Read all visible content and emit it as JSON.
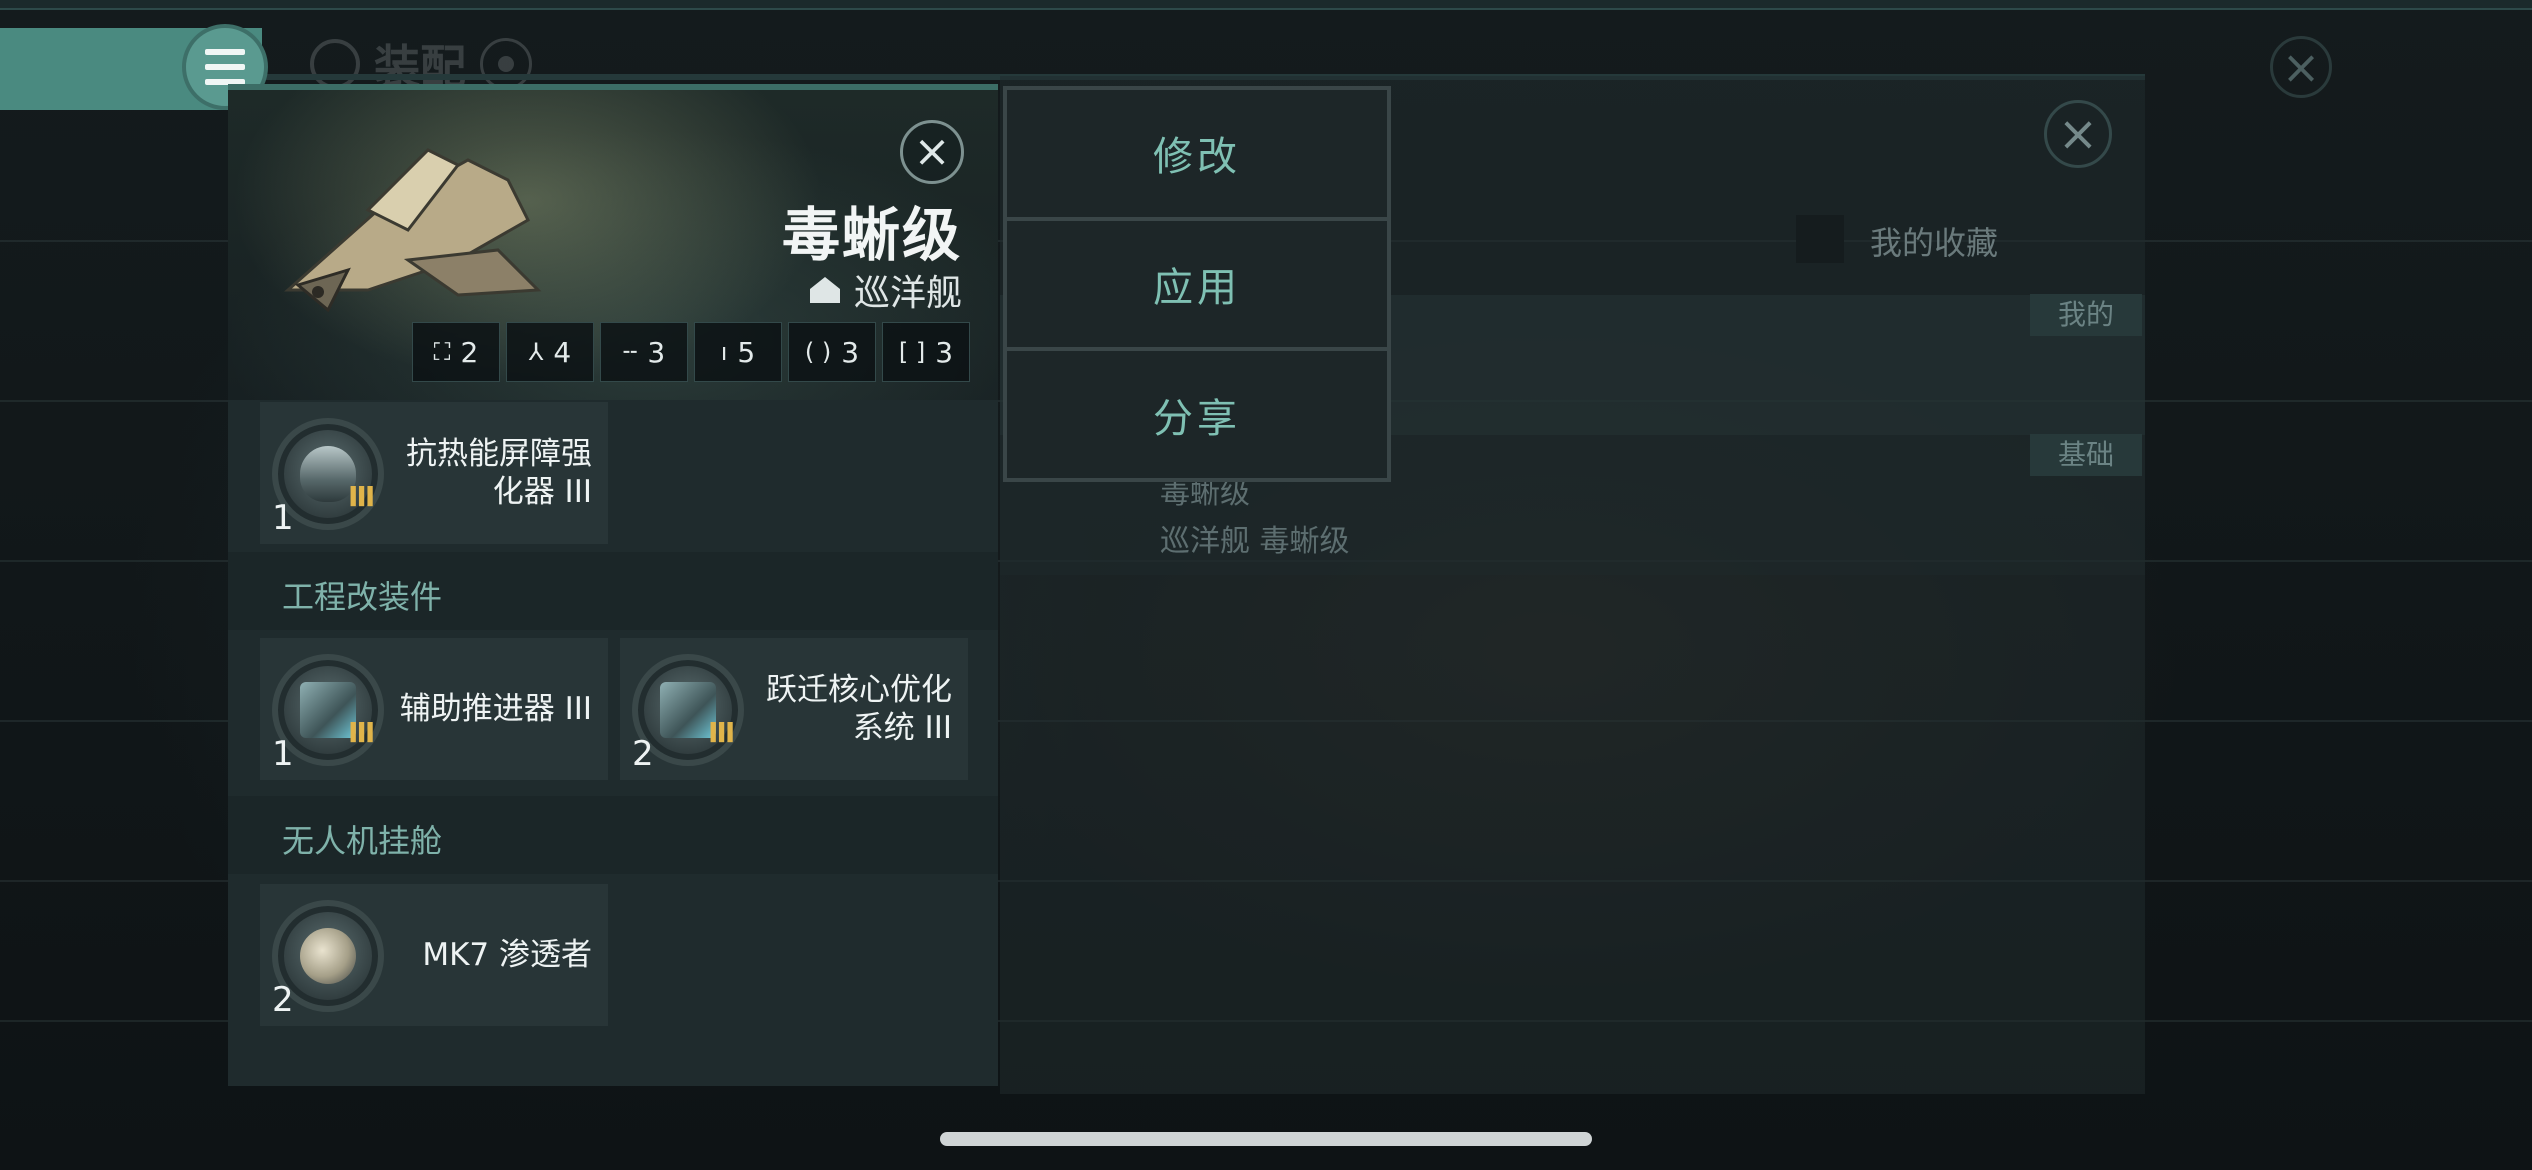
{
  "background": {
    "title": "装配",
    "favorites_label": "我的收藏",
    "tag_mine": "我的",
    "tag_base": "基础",
    "fit_name": "毒蜥级",
    "fit_sub": "巡洋舰 毒蜥级"
  },
  "card": {
    "ship_name": "毒蜥级",
    "ship_class": "巡洋舰",
    "slots": [
      {
        "icon": "high-slot-icon",
        "glyph": "⛶",
        "count": "2"
      },
      {
        "icon": "turret-icon",
        "glyph": "⅄",
        "count": "4"
      },
      {
        "icon": "mid-slot-icon",
        "glyph": "╌",
        "count": "3"
      },
      {
        "icon": "low-slot-icon",
        "glyph": "ı",
        "count": "5"
      },
      {
        "icon": "rig-slot-icon",
        "glyph": "( )",
        "count": "3"
      },
      {
        "icon": "subsystem-slot-icon",
        "glyph": "[ ]",
        "count": "3"
      }
    ],
    "modules_top": [
      {
        "qty": "1",
        "name": "抗热能屏障强化器 III",
        "tier": "III",
        "icon": "shield-hardener-icon"
      }
    ],
    "sections": [
      {
        "title": "工程改装件",
        "modules": [
          {
            "qty": "1",
            "name": "辅助推进器 III",
            "tier": "III",
            "icon": "thruster-rig-icon"
          },
          {
            "qty": "2",
            "name": "跃迁核心优化系统 III",
            "tier": "III",
            "icon": "warp-core-rig-icon"
          }
        ]
      },
      {
        "title": "无人机挂舱",
        "modules": [
          {
            "qty": "2",
            "name": "MK7 渗透者",
            "tier": "",
            "icon": "drone-icon"
          }
        ]
      }
    ]
  },
  "popup": {
    "options": [
      "修改",
      "应用",
      "分享"
    ]
  }
}
